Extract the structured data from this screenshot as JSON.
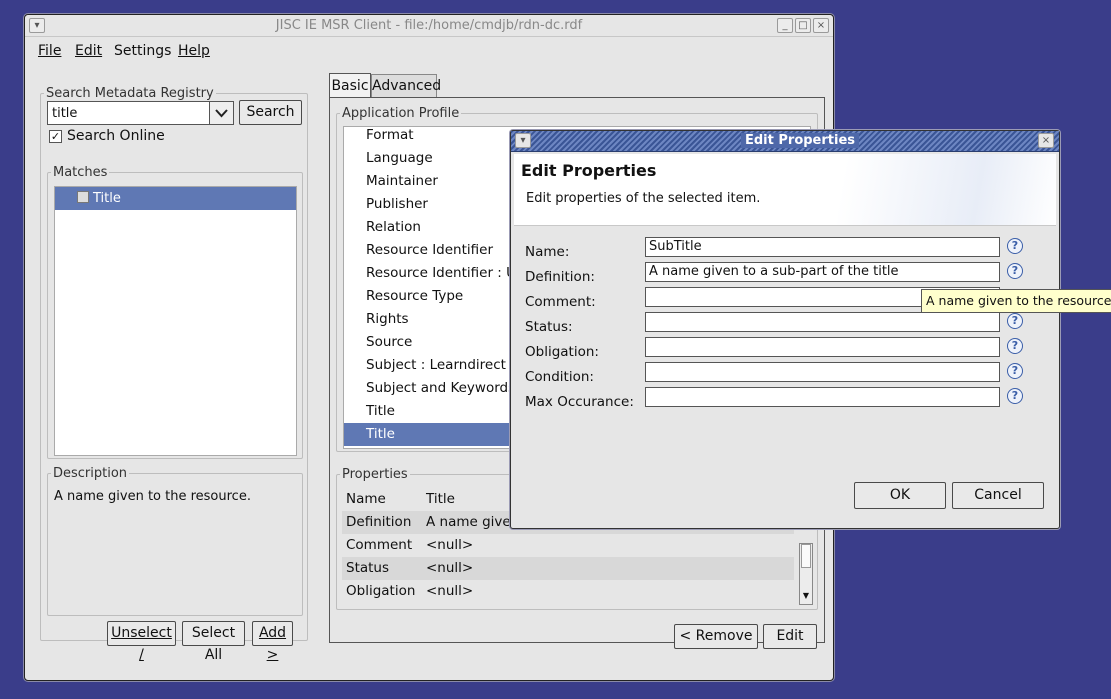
{
  "window": {
    "title": "JISC IE MSR Client - file:/home/cmdjb/rdn-dc.rdf"
  },
  "menus": {
    "file": "File",
    "edit": "Edit",
    "settings": "Settings",
    "help": "Help"
  },
  "search": {
    "group": "Search Metadata Registry",
    "value": "title",
    "button": "Search",
    "online_label": "Search Online",
    "online_checked": true
  },
  "matches": {
    "group": "Matches",
    "items": [
      {
        "label": "Title",
        "checked": false
      }
    ]
  },
  "description": {
    "group": "Description",
    "text": "A name given to the resource."
  },
  "left_buttons": {
    "unselect": "Unselect /",
    "select_all": "Select All",
    "add": "Add >"
  },
  "tabs": {
    "basic": "Basic",
    "advanced": "Advanced"
  },
  "app_profile": {
    "group": "Application Profile",
    "items": [
      "Format",
      "Language",
      "Maintainer",
      "Publisher",
      "Relation",
      "Resource Identifier",
      "Resource Identifier : URI",
      "Resource Type",
      "Rights",
      "Source",
      "Subject : Learndirect",
      "Subject and Keywords",
      "Title",
      "Title"
    ],
    "selected_index": 13
  },
  "properties": {
    "group": "Properties",
    "header": {
      "name": "Name",
      "value": "Title"
    },
    "rows": [
      {
        "name": "Definition",
        "value": "A name given to"
      },
      {
        "name": "Comment",
        "value": "<null>"
      },
      {
        "name": "Status",
        "value": "<null>"
      },
      {
        "name": "Obligation",
        "value": "<null>"
      }
    ]
  },
  "right_buttons": {
    "remove": "<  Remove",
    "edit": "Edit"
  },
  "dialog": {
    "title": "Edit Properties",
    "heading": "Edit Properties",
    "subheading": "Edit properties of the selected item.",
    "fields": [
      {
        "label": "Name:",
        "value": "SubTitle"
      },
      {
        "label": "Definition:",
        "value": "A name given to a sub-part of the title"
      },
      {
        "label": "Comment:",
        "value": ""
      },
      {
        "label": "Status:",
        "value": ""
      },
      {
        "label": "Obligation:",
        "value": ""
      },
      {
        "label": "Condition:",
        "value": ""
      },
      {
        "label": "Max Occurance:",
        "value": ""
      }
    ],
    "ok": "OK",
    "cancel": "Cancel",
    "help_glyph": "?"
  },
  "tooltip": {
    "text": "A name given to the resource."
  }
}
